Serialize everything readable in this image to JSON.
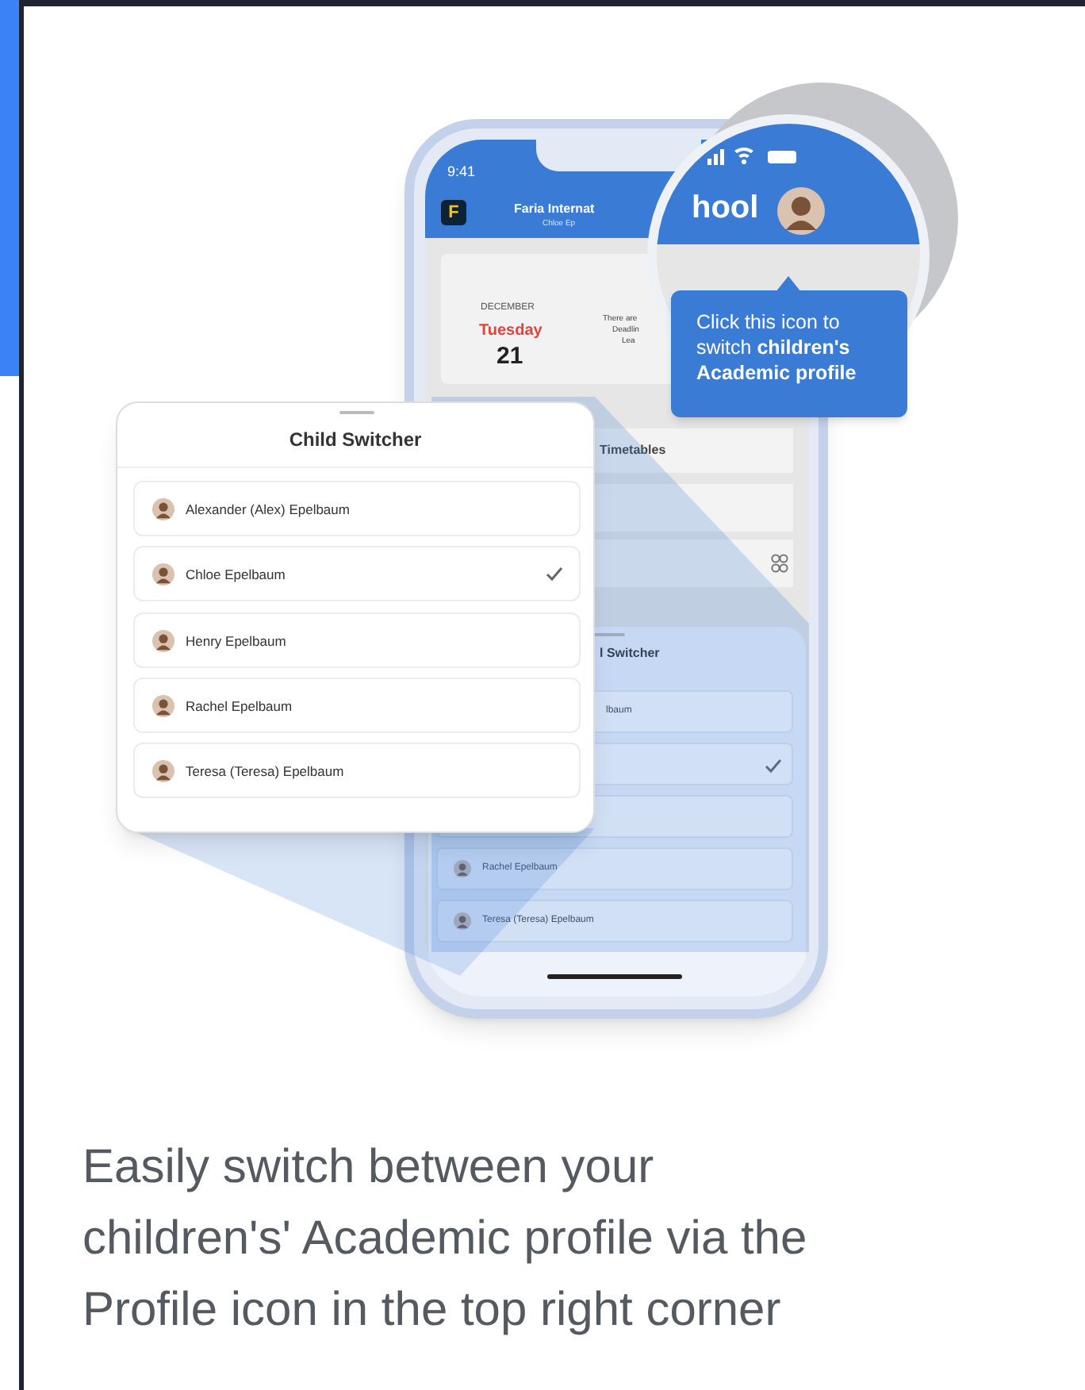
{
  "phone": {
    "status_time": "9:41",
    "app_logo": "F",
    "school_name": "Faria Internat",
    "student_name": "Chloe Ep",
    "calendar": {
      "month": "DECEMBER",
      "weekday": "Tuesday",
      "day": "21"
    },
    "notice_lines": [
      "There are",
      "Deadlin",
      "Lea"
    ],
    "menu_items": [
      "Timetables"
    ],
    "sheet": {
      "title": "l Switcher",
      "rows": [
        {
          "name": "lbaum",
          "avatar": false,
          "selected": false
        },
        {
          "avatar": false,
          "selected": true
        },
        {
          "avatar": false,
          "selected": false
        },
        {
          "name": "Rachel Epelbaum",
          "avatar": true,
          "selected": false
        },
        {
          "name": "Teresa (Teresa) Epelbaum",
          "avatar": true,
          "selected": false
        }
      ]
    }
  },
  "magnifier": {
    "school_name_part": "hool"
  },
  "callout": {
    "text": "Click this icon to switch **children's Academic profile**"
  },
  "child_switcher": {
    "title": "Child Switcher",
    "children": [
      {
        "name": "Alexander (Alex) Epelbaum",
        "selected": false
      },
      {
        "name": "Chloe Epelbaum",
        "selected": true
      },
      {
        "name": "Henry Epelbaum",
        "selected": false
      },
      {
        "name": "Rachel Epelbaum",
        "selected": false
      },
      {
        "name": "Teresa (Teresa) Epelbaum",
        "selected": false
      }
    ]
  },
  "caption": {
    "lines": [
      "Easily switch between your",
      "children's' Academic profile via the",
      "Profile icon in the top right corner"
    ]
  }
}
